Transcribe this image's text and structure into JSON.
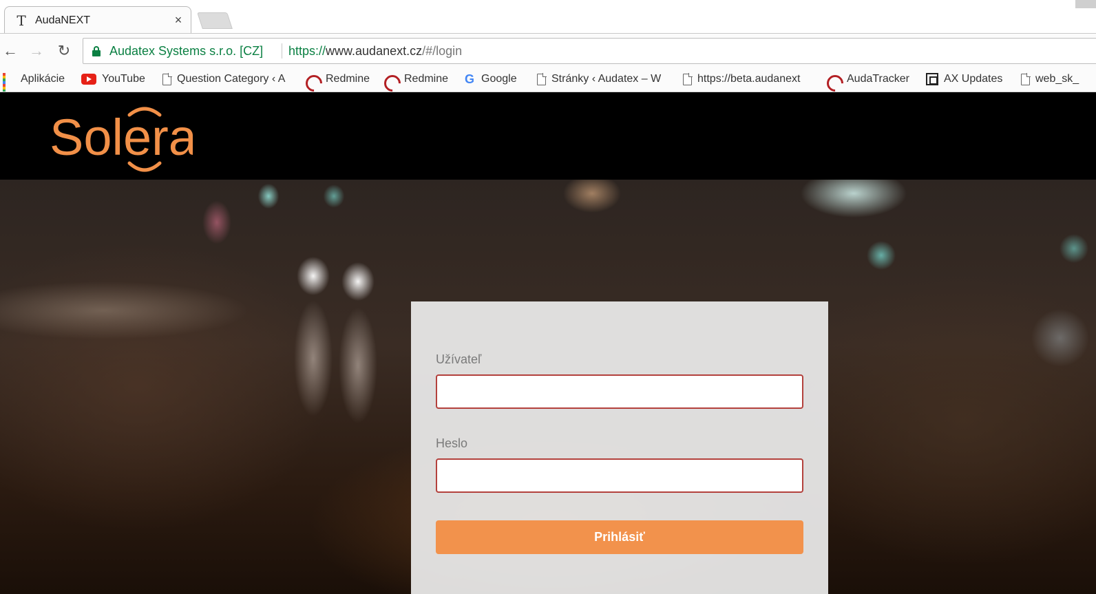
{
  "browser": {
    "tab": {
      "title": "AudaNEXT",
      "close_glyph": "×"
    },
    "toolbar": {
      "back_glyph": "←",
      "forward_glyph": "→",
      "reload_glyph": "↻",
      "site_identity": "Audatex Systems s.r.o. [CZ]",
      "url": {
        "scheme": "https://",
        "host": "www.audanext.cz",
        "path": "/#/login"
      }
    },
    "bookmarks": [
      {
        "label": "Aplikácie",
        "icon": "apps-grid-icon"
      },
      {
        "label": "YouTube",
        "icon": "youtube-icon"
      },
      {
        "label": "Question Category ‹ A",
        "icon": "page-icon"
      },
      {
        "label": "Redmine",
        "icon": "redmine-icon"
      },
      {
        "label": "Redmine",
        "icon": "redmine-icon"
      },
      {
        "label": "Google",
        "icon": "google-icon"
      },
      {
        "label": "Stránky ‹ Audatex – W",
        "icon": "page-icon"
      },
      {
        "label": "https://beta.audanext",
        "icon": "page-icon"
      },
      {
        "label": "AudaTracker",
        "icon": "redmine-icon"
      },
      {
        "label": "AX Updates",
        "icon": "ax-updates-icon"
      },
      {
        "label": "web_sk_",
        "icon": "page-icon"
      }
    ],
    "colors": {
      "secure_green": "#0b8043"
    }
  },
  "page": {
    "logo": {
      "text": "Solera",
      "color": "#f29048"
    },
    "login": {
      "username_label": "Užívateľ",
      "username_value": "",
      "password_label": "Heslo",
      "password_value": "",
      "submit_label": "Prihlásiť"
    },
    "colors": {
      "accent": "#f2924c",
      "input_border": "#b3403c",
      "card_bg": "#ececec"
    }
  }
}
